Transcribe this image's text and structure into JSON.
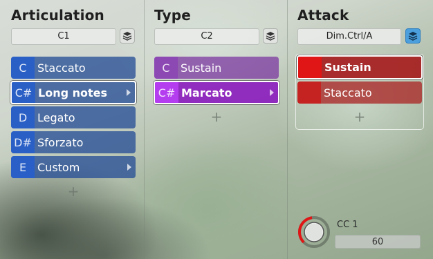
{
  "columns": {
    "articulation": {
      "title": "Articulation",
      "key": "C1",
      "items": [
        {
          "note": "C",
          "label": "Staccato"
        },
        {
          "note": "C#",
          "label": "Long notes"
        },
        {
          "note": "D",
          "label": "Legato"
        },
        {
          "note": "D#",
          "label": "Sforzato"
        },
        {
          "note": "E",
          "label": "Custom"
        }
      ]
    },
    "type": {
      "title": "Type",
      "key": "C2",
      "items": [
        {
          "note": "C",
          "label": "Sustain"
        },
        {
          "note": "C#",
          "label": "Marcato"
        }
      ]
    },
    "attack": {
      "title": "Attack",
      "key": "Dim.Ctrl/A",
      "items": [
        {
          "note": "",
          "label": "Sustain"
        },
        {
          "note": "",
          "label": "Staccato"
        }
      ]
    }
  },
  "add_symbol": "+",
  "cc": {
    "label": "CC 1",
    "value": "60",
    "level": 0.47
  },
  "colors": {
    "accent_blue": "#4a9fdc",
    "articulation_blue": "#2850c8",
    "type_purple": "#b53df0",
    "attack_red": "#e01616"
  },
  "icons": {
    "layer_button": "layers-icon",
    "submenu_arrow": "chevron-right-icon",
    "add": "plus-icon"
  }
}
